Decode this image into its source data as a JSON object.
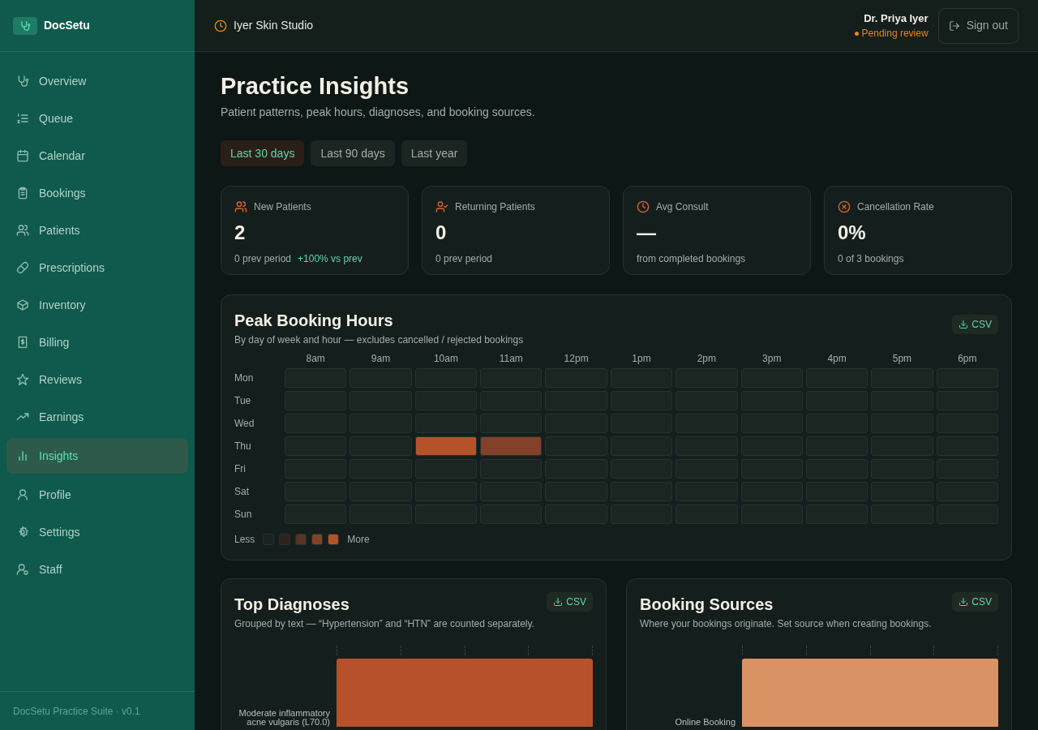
{
  "brand": {
    "name": "DocSetu"
  },
  "sidebar": {
    "items": [
      {
        "label": "Overview",
        "selected": false
      },
      {
        "label": "Queue",
        "selected": false
      },
      {
        "label": "Calendar",
        "selected": false
      },
      {
        "label": "Bookings",
        "selected": false
      },
      {
        "label": "Patients",
        "selected": false
      },
      {
        "label": "Prescriptions",
        "selected": false
      },
      {
        "label": "Inventory",
        "selected": false
      },
      {
        "label": "Billing",
        "selected": false
      },
      {
        "label": "Reviews",
        "selected": false
      },
      {
        "label": "Earnings",
        "selected": false
      },
      {
        "label": "Insights",
        "selected": true
      },
      {
        "label": "Profile",
        "selected": false
      },
      {
        "label": "Settings",
        "selected": false
      },
      {
        "label": "Staff",
        "selected": false
      }
    ],
    "footer": "DocSetu Practice Suite · v0.1"
  },
  "header": {
    "clinic": "Iyer Skin Studio",
    "user": "Dr. Priya Iyer",
    "status": "Pending review",
    "sign_out": "Sign out"
  },
  "page": {
    "title": "Practice Insights",
    "subtitle": "Patient patterns, peak hours, diagnoses, and booking sources."
  },
  "ranges": [
    {
      "label": "Last 30 days",
      "selected": true
    },
    {
      "label": "Last 90 days",
      "selected": false
    },
    {
      "label": "Last year",
      "selected": false
    }
  ],
  "stats": [
    {
      "label": "New Patients",
      "value": "2",
      "note": "0 prev period",
      "delta": "+100% vs prev"
    },
    {
      "label": "Returning Patients",
      "value": "0",
      "note": "0 prev period"
    },
    {
      "label": "Avg Consult",
      "value": "—",
      "note": "from completed bookings"
    },
    {
      "label": "Cancellation Rate",
      "value": "0%",
      "note": "0 of 3 bookings"
    }
  ],
  "heatmap": {
    "title": "Peak Booking Hours",
    "subtitle": "By day of week and hour — excludes cancelled / rejected bookings",
    "csv": "CSV",
    "hours": [
      "8am",
      "9am",
      "10am",
      "11am",
      "12pm",
      "1pm",
      "2pm",
      "3pm",
      "4pm",
      "5pm",
      "6pm"
    ],
    "rows": [
      {
        "day": "Mon",
        "cells": [
          {
            "color": "#1b2522"
          },
          {
            "color": "#1b2522"
          },
          {
            "color": "#1b2522"
          },
          {
            "color": "#1b2522"
          },
          {
            "color": "#1b2522"
          },
          {
            "color": "#1b2522"
          },
          {
            "color": "#1b2522"
          },
          {
            "color": "#1b2522"
          },
          {
            "color": "#1b2522"
          },
          {
            "color": "#1b2522"
          },
          {
            "color": "#1b2522"
          }
        ]
      },
      {
        "day": "Tue",
        "cells": [
          {
            "color": "#1b2522"
          },
          {
            "color": "#1b2522"
          },
          {
            "color": "#1b2522"
          },
          {
            "color": "#1b2522"
          },
          {
            "color": "#1b2522"
          },
          {
            "color": "#1b2522"
          },
          {
            "color": "#1b2522"
          },
          {
            "color": "#1b2522"
          },
          {
            "color": "#1b2522"
          },
          {
            "color": "#1b2522"
          },
          {
            "color": "#1b2522"
          }
        ]
      },
      {
        "day": "Wed",
        "cells": [
          {
            "color": "#1b2522"
          },
          {
            "color": "#1b2522"
          },
          {
            "color": "#1b2522"
          },
          {
            "color": "#1b2522"
          },
          {
            "color": "#1b2522"
          },
          {
            "color": "#1b2522"
          },
          {
            "color": "#1b2522"
          },
          {
            "color": "#1b2522"
          },
          {
            "color": "#1b2522"
          },
          {
            "color": "#1b2522"
          },
          {
            "color": "#1b2522"
          }
        ]
      },
      {
        "day": "Thu",
        "cells": [
          {
            "color": "#1b2522"
          },
          {
            "color": "#1b2522"
          },
          {
            "color": "#b5522c"
          },
          {
            "color": "#83412a"
          },
          {
            "color": "#1b2522"
          },
          {
            "color": "#1b2522"
          },
          {
            "color": "#1b2522"
          },
          {
            "color": "#1b2522"
          },
          {
            "color": "#1b2522"
          },
          {
            "color": "#1b2522"
          },
          {
            "color": "#1b2522"
          }
        ]
      },
      {
        "day": "Fri",
        "cells": [
          {
            "color": "#1b2522"
          },
          {
            "color": "#1b2522"
          },
          {
            "color": "#1b2522"
          },
          {
            "color": "#1b2522"
          },
          {
            "color": "#1b2522"
          },
          {
            "color": "#1b2522"
          },
          {
            "color": "#1b2522"
          },
          {
            "color": "#1b2522"
          },
          {
            "color": "#1b2522"
          },
          {
            "color": "#1b2522"
          },
          {
            "color": "#1b2522"
          }
        ]
      },
      {
        "day": "Sat",
        "cells": [
          {
            "color": "#1b2522"
          },
          {
            "color": "#1b2522"
          },
          {
            "color": "#1b2522"
          },
          {
            "color": "#1b2522"
          },
          {
            "color": "#1b2522"
          },
          {
            "color": "#1b2522"
          },
          {
            "color": "#1b2522"
          },
          {
            "color": "#1b2522"
          },
          {
            "color": "#1b2522"
          },
          {
            "color": "#1b2522"
          },
          {
            "color": "#1b2522"
          }
        ]
      },
      {
        "day": "Sun",
        "cells": [
          {
            "color": "#1b2522"
          },
          {
            "color": "#1b2522"
          },
          {
            "color": "#1b2522"
          },
          {
            "color": "#1b2522"
          },
          {
            "color": "#1b2522"
          },
          {
            "color": "#1b2522"
          },
          {
            "color": "#1b2522"
          },
          {
            "color": "#1b2522"
          },
          {
            "color": "#1b2522"
          },
          {
            "color": "#1b2522"
          },
          {
            "color": "#1b2522"
          }
        ]
      }
    ],
    "legend": {
      "less": "Less",
      "more": "More",
      "swatches": [
        {
          "color": "#1a211e"
        },
        {
          "color": "#2e231c"
        },
        {
          "color": "#5a3424"
        },
        {
          "color": "#83412a"
        },
        {
          "color": "#b5522c"
        }
      ]
    }
  },
  "panels": [
    {
      "title": "Top Diagnoses",
      "subtitle": "Grouped by text — “Hypertension” and “HTN” are counted separately.",
      "csv": "CSV",
      "bars": [
        {
          "label": "Moderate inflammatory acne vulgaris (L70.0)",
          "color": "#b5522c"
        }
      ]
    },
    {
      "title": "Booking Sources",
      "subtitle": "Where your bookings originate. Set source when creating bookings.",
      "csv": "CSV",
      "bars": [
        {
          "label": "Online Booking",
          "color": "#d99264"
        }
      ]
    }
  ]
}
